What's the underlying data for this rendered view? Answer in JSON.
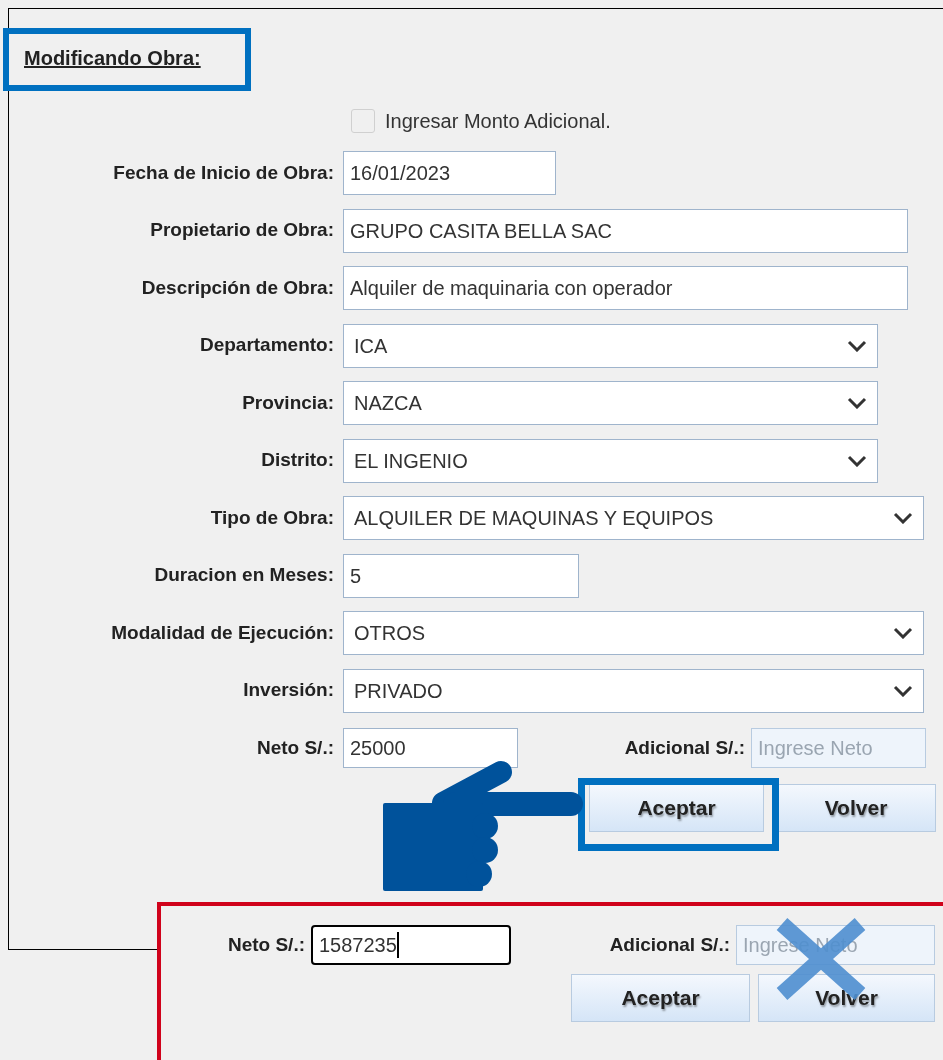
{
  "form": {
    "title": "Modificando Obra:",
    "additional_amount": {
      "label": "Ingresar Monto Adicional.",
      "checked": false
    },
    "fields": [
      {
        "kind": "text",
        "label": "Fecha de Inicio de Obra:",
        "value": "16/01/2023"
      },
      {
        "kind": "text",
        "label": "Propietario de Obra:",
        "value": "GRUPO CASITA BELLA SAC"
      },
      {
        "kind": "text",
        "label": "Descripción de Obra:",
        "value": "Alquiler de maquinaria con operador"
      },
      {
        "kind": "select",
        "label": "Departamento:",
        "value": "ICA"
      },
      {
        "kind": "select",
        "label": "Provincia:",
        "value": "NAZCA"
      },
      {
        "kind": "select",
        "label": "Distrito:",
        "value": "EL INGENIO"
      },
      {
        "kind": "select",
        "label": "Tipo de Obra:",
        "value": "ALQUILER DE MAQUINAS Y EQUIPOS"
      },
      {
        "kind": "text",
        "label": "Duracion en Meses:",
        "value": "5"
      },
      {
        "kind": "select",
        "label": "Modalidad de Ejecución:",
        "value": "OTROS"
      },
      {
        "kind": "select",
        "label": "Inversión:",
        "value": "PRIVADO"
      }
    ],
    "neto": {
      "label": "Neto S/.:",
      "value": "25000",
      "focused": false
    },
    "adicional": {
      "label": "Adicional S/.:",
      "placeholder": "Ingrese Neto"
    },
    "buttons": [
      "Aceptar",
      "Volver"
    ]
  },
  "callout": {
    "neto": {
      "label": "Neto S/.:",
      "value": "1587235",
      "focused": true
    },
    "adicional": {
      "label": "Adicional S/.:",
      "placeholder": "Ingrese Neto"
    },
    "buttons": [
      "Aceptar",
      "Volver"
    ]
  }
}
